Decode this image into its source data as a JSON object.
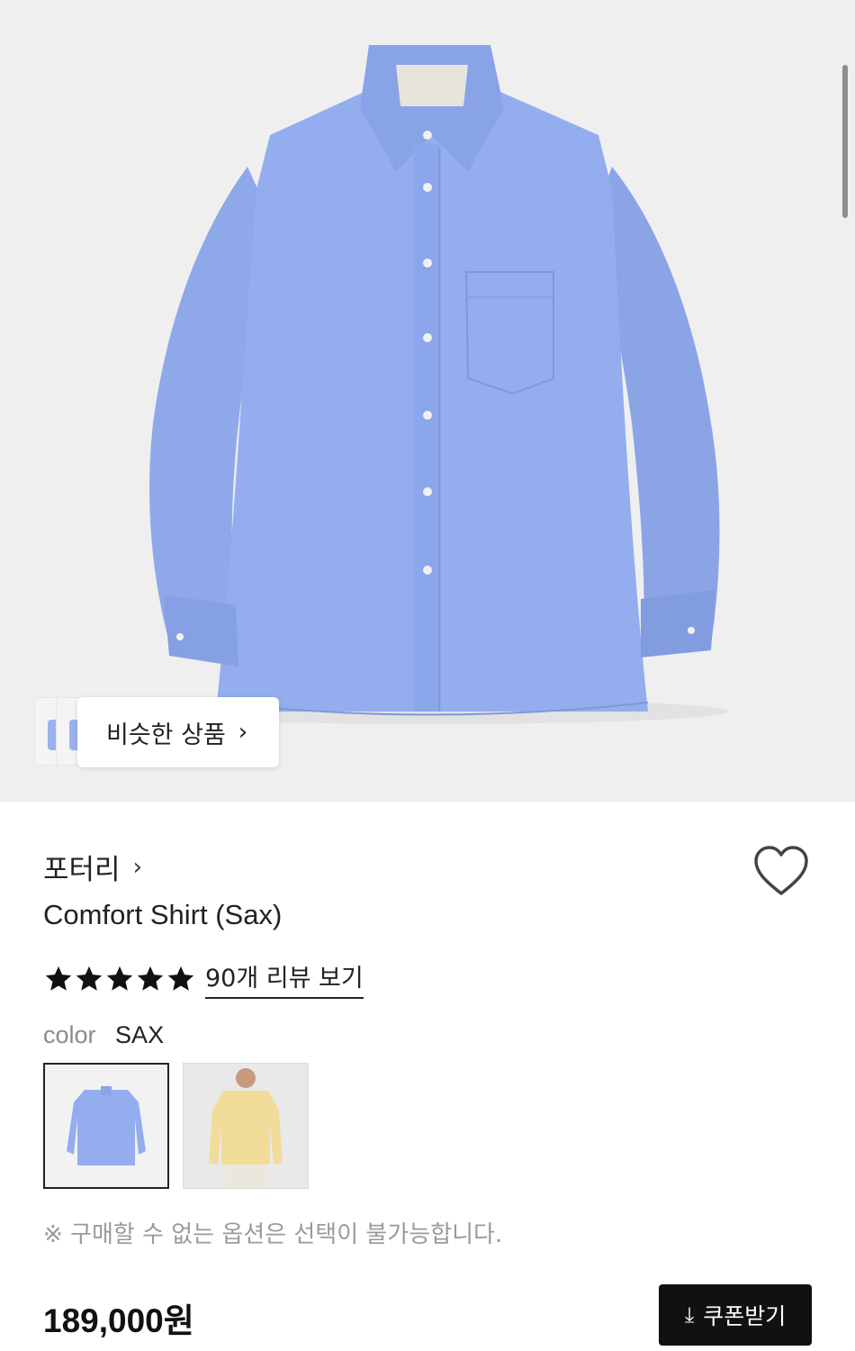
{
  "similar_products": {
    "label": "비슷한 상품",
    "chevron": "›"
  },
  "product": {
    "brand": "포터리",
    "brand_chevron": "›",
    "name": "Comfort Shirt (Sax)",
    "rating_stars": 5,
    "reviews_link": "90개 리뷰 보기",
    "color_label": "color",
    "color_value": "SAX",
    "notice": "※ 구매할 수 없는 옵션은 선택이 불가능합니다.",
    "price": "189,000원"
  },
  "coupon_button": {
    "label": "쿠폰받기",
    "icon": "download-icon"
  },
  "icons": {
    "wishlist": "heart-icon",
    "rating": "star-icon"
  },
  "colors": {
    "shirt_blue": "#8fa9ea",
    "swatch_yellow": "#f2dc9a",
    "button_bg": "#111111"
  }
}
